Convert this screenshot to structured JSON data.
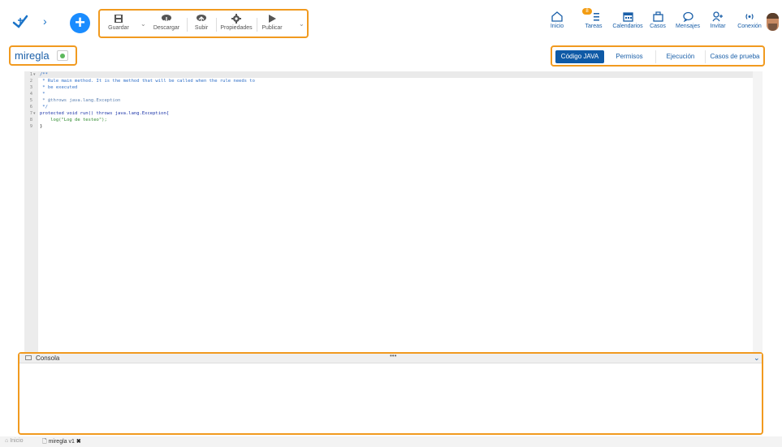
{
  "toolbar": {
    "guardar": "Guardar",
    "descargar": "Descargar",
    "subir": "Subir",
    "propiedades": "Propiedades",
    "publicar": "Publicar"
  },
  "nav": {
    "inicio": "Inicio",
    "tareas": "Tareas",
    "tareas_badge": "8",
    "calendarios": "Calendarios",
    "casos": "Casos",
    "mensajes": "Mensajes",
    "invitar": "Invitar",
    "conexion": "Conexión"
  },
  "rule": {
    "name": "miregla",
    "status_color": "#5cb85c"
  },
  "tabs": {
    "codigo": "Código JAVA",
    "permisos": "Permisos",
    "ejecucion": "Ejecución",
    "casos_prueba": "Casos de prueba"
  },
  "editor": {
    "lines": [
      {
        "n": "1",
        "fold": true,
        "text": "/**"
      },
      {
        "n": "2",
        "text": " * Rule main method. It is the method that will be called when the rule needs to"
      },
      {
        "n": "3",
        "text": " * be executed"
      },
      {
        "n": "4",
        "text": " *"
      },
      {
        "n": "5",
        "text": " * @throws java.lang.Exception"
      },
      {
        "n": "6",
        "text": " */"
      },
      {
        "n": "7",
        "fold": true,
        "text": "protected void run() throws java.lang.Exception{"
      },
      {
        "n": "8",
        "text": "    log(\"Log de testeo\");"
      },
      {
        "n": "9",
        "text": "}"
      }
    ]
  },
  "console": {
    "title": "Consola",
    "dots": "•••"
  },
  "bottom": {
    "home": "Inicio",
    "file": "miregla v1",
    "close": "✖"
  },
  "colors": {
    "highlight": "#f19a1f",
    "accent": "#0f5aa6",
    "add_button": "#1a8cff"
  }
}
